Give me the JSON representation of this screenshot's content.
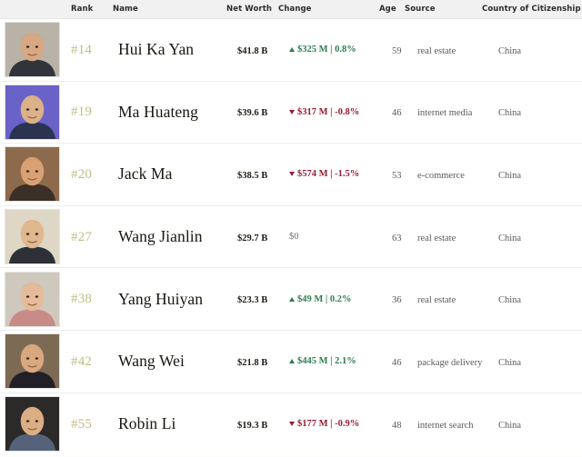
{
  "table": {
    "columns": [
      {
        "key": "photo",
        "label": ""
      },
      {
        "key": "rank",
        "label": "Rank"
      },
      {
        "key": "name",
        "label": "Name"
      },
      {
        "key": "worth",
        "label": "Net Worth"
      },
      {
        "key": "change",
        "label": "Change"
      },
      {
        "key": "age",
        "label": "Age"
      },
      {
        "key": "source",
        "label": "Source"
      },
      {
        "key": "country",
        "label": "Country of Citizenship"
      }
    ],
    "colors": {
      "header_background": "#f1f1f1",
      "header_text": "#2b2b2b",
      "rank_text": "#c3bc82",
      "name_text": "#19170f",
      "gain_green": "#2e7d4f",
      "loss_red": "#9b1b30",
      "neutral_gray": "#6f6f6f",
      "row_divider": "#ededed"
    },
    "rows": [
      {
        "rank": "#14",
        "name": "Hui Ka Yan",
        "worth": "$41.8 B",
        "change": "$325 M | 0.8%",
        "direction": "up",
        "age": "59",
        "source": "real estate",
        "country": "China",
        "photo": {
          "name": "portrait-hui-ka-yan",
          "skin": "#d8a882",
          "hair": "#241c16",
          "bg": "#b9b2a6",
          "shirt": "#32343c"
        }
      },
      {
        "rank": "#19",
        "name": "Ma Huateng",
        "worth": "$39.6 B",
        "change": "$317 M | -0.8%",
        "direction": "down",
        "age": "46",
        "source": "internet media",
        "country": "China",
        "photo": {
          "name": "portrait-ma-huateng",
          "skin": "#dcb089",
          "hair": "#1b1712",
          "bg": "#6b62c8",
          "shirt": "#2a3350"
        }
      },
      {
        "rank": "#20",
        "name": "Jack Ma",
        "worth": "$38.5 B",
        "change": "$574 M | -1.5%",
        "direction": "down",
        "age": "53",
        "source": "e-commerce",
        "country": "China",
        "photo": {
          "name": "portrait-jack-ma",
          "skin": "#d9a173",
          "hair": "#15110d",
          "bg": "#8d6a4b",
          "shirt": "#3b2f28"
        }
      },
      {
        "rank": "#27",
        "name": "Wang Jianlin",
        "worth": "$29.7 B",
        "change": "$0",
        "direction": "flat",
        "age": "63",
        "source": "real estate",
        "country": "China",
        "photo": {
          "name": "portrait-wang-jianlin",
          "skin": "#e0b78e",
          "hair": "#201a14",
          "bg": "#ded7c6",
          "shirt": "#2e3038"
        }
      },
      {
        "rank": "#38",
        "name": "Yang Huiyan",
        "worth": "$23.3 B",
        "change": "$49 M | 0.2%",
        "direction": "up",
        "age": "36",
        "source": "real estate",
        "country": "China",
        "photo": {
          "name": "portrait-yang-huiyan",
          "skin": "#e5bb99",
          "hair": "#14100c",
          "bg": "#cfc9bd",
          "shirt": "#c98b86"
        }
      },
      {
        "rank": "#42",
        "name": "Wang Wei",
        "worth": "$21.8 B",
        "change": "$445 M | 2.1%",
        "direction": "up",
        "age": "46",
        "source": "package delivery",
        "country": "China",
        "photo": {
          "name": "portrait-wang-wei",
          "skin": "#d9a87f",
          "hair": "#181310",
          "bg": "#7d6a55",
          "shirt": "#222026"
        }
      },
      {
        "rank": "#55",
        "name": "Robin Li",
        "worth": "$19.3 B",
        "change": "$177 M | -0.9%",
        "direction": "down",
        "age": "48",
        "source": "internet search",
        "country": "China",
        "photo": {
          "name": "portrait-robin-li",
          "skin": "#dbae85",
          "hair": "#191411",
          "bg": "#2c2a28",
          "shirt": "#55627a"
        }
      }
    ]
  }
}
